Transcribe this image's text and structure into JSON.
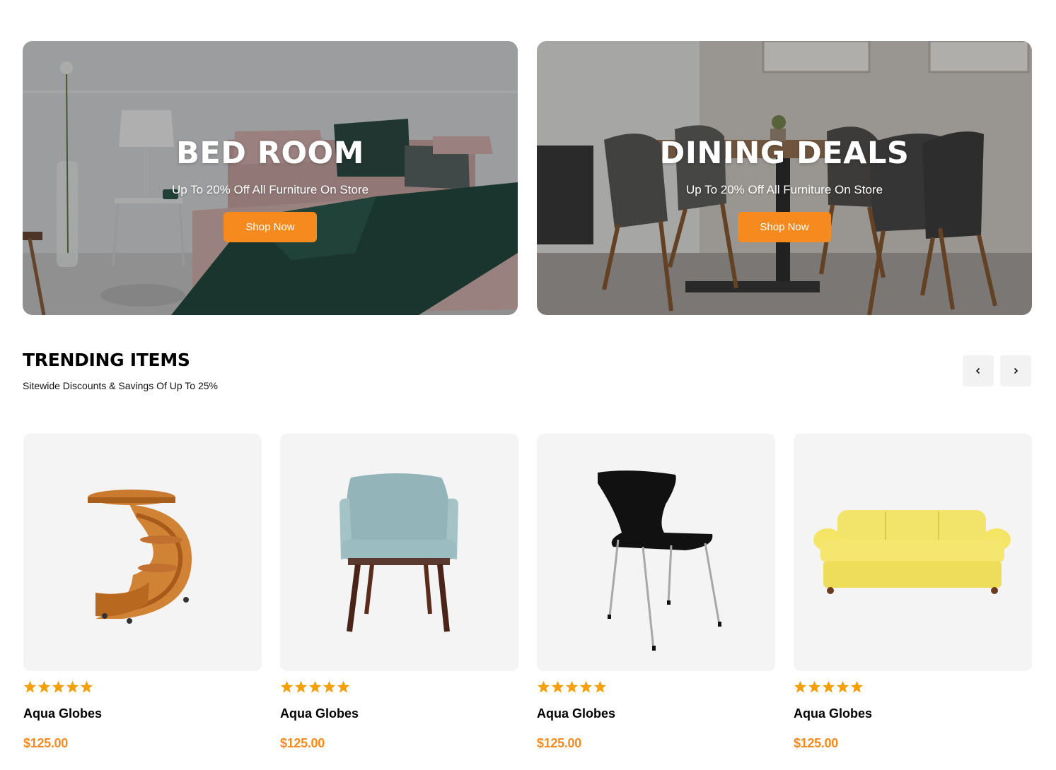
{
  "banners": [
    {
      "title": "BED ROOM",
      "subtitle": "Up To 20% Off All Furniture On Store",
      "button_label": "Shop Now"
    },
    {
      "title": "DINING DEALS",
      "subtitle": "Up To 20% Off All Furniture On Store",
      "button_label": "Shop Now"
    }
  ],
  "trending": {
    "title": "TRENDING ITEMS",
    "subtitle": "Sitewide Discounts & Savings Of Up To 25%",
    "nav": {
      "prev_icon": "chevron-left-icon",
      "next_icon": "chevron-right-icon"
    },
    "products": [
      {
        "name": "Aqua Globes",
        "price": "$125.00",
        "rating": 5,
        "image": "wooden-side-table"
      },
      {
        "name": "Aqua Globes",
        "price": "$125.00",
        "rating": 5,
        "image": "teal-armchair"
      },
      {
        "name": "Aqua Globes",
        "price": "$125.00",
        "rating": 5,
        "image": "black-chair"
      },
      {
        "name": "Aqua Globes",
        "price": "$125.00",
        "rating": 5,
        "image": "yellow-sofa"
      }
    ]
  },
  "colors": {
    "accent": "#f68a1e",
    "star": "#f5a00b",
    "card_bg": "#f4f4f4",
    "nav_bg": "#f2f2f2"
  }
}
